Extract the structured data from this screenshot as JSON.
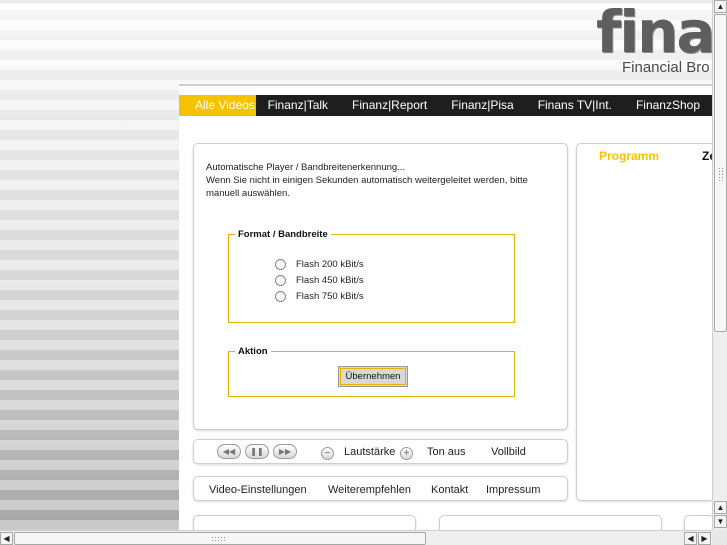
{
  "logo": {
    "word": "finan",
    "subtitle": "Financial Bro"
  },
  "nav": {
    "items": [
      {
        "label": "Alle Videos"
      },
      {
        "label": "Finanz|Talk"
      },
      {
        "label": "Finanz|Report"
      },
      {
        "label": "Finanz|Pisa"
      },
      {
        "label": "Finans TV|Int."
      },
      {
        "label": "FinanzShop"
      }
    ]
  },
  "info": {
    "line1": "Automatische Player / Bandbreitenerkennung...",
    "line2": "Wenn Sie nicht in einigen Sekunden automatisch weitergeleitet werden, bitte manuell auswählen."
  },
  "format": {
    "legend": "Format / Bandbreite",
    "options": [
      {
        "label": "Flash 200 kBit/s"
      },
      {
        "label": "Flash 450 kBit/s"
      },
      {
        "label": "Flash 750 kBit/s"
      }
    ]
  },
  "aktion": {
    "legend": "Aktion",
    "button": "Übernehmen"
  },
  "sidebar": {
    "tab_active": "Programm",
    "tab_other": "Zeit"
  },
  "controls": {
    "rewind": "◀◀",
    "pause": "❚❚",
    "forward": "▶▶",
    "vol_down": "−",
    "volume_label": "Lautstärke",
    "vol_up": "+",
    "mute": "Ton aus",
    "fullscreen": "Vollbild"
  },
  "links": {
    "video_settings": "Video-Einstellungen",
    "recommend": "Weiterempfehlen",
    "contact": "Kontakt",
    "imprint": "Impressum"
  },
  "scroll": {
    "up": "▲",
    "down": "▼",
    "left": "◀",
    "right": "▶"
  },
  "colors": {
    "accent": "#f7c300",
    "nav_bg": "#1e1e1e"
  }
}
